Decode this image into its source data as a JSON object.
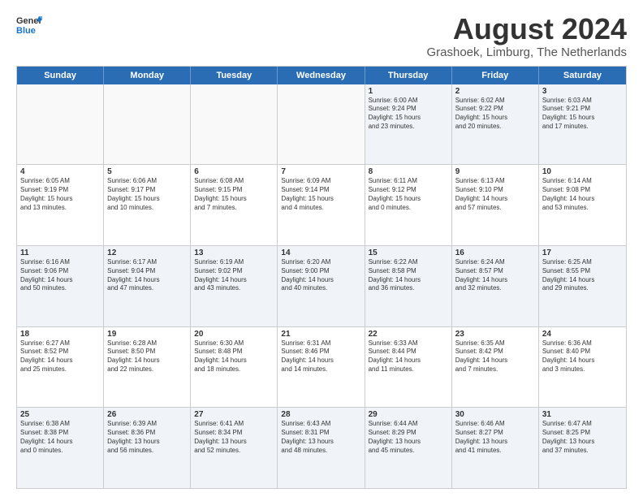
{
  "logo": {
    "text_general": "General",
    "text_blue": "Blue"
  },
  "title": "August 2024",
  "subtitle": "Grashoek, Limburg, The Netherlands",
  "header_days": [
    "Sunday",
    "Monday",
    "Tuesday",
    "Wednesday",
    "Thursday",
    "Friday",
    "Saturday"
  ],
  "rows": [
    [
      {
        "day": "",
        "info": "",
        "empty": true
      },
      {
        "day": "",
        "info": "",
        "empty": true
      },
      {
        "day": "",
        "info": "",
        "empty": true
      },
      {
        "day": "",
        "info": "",
        "empty": true
      },
      {
        "day": "1",
        "info": "Sunrise: 6:00 AM\nSunset: 9:24 PM\nDaylight: 15 hours\nand 23 minutes."
      },
      {
        "day": "2",
        "info": "Sunrise: 6:02 AM\nSunset: 9:22 PM\nDaylight: 15 hours\nand 20 minutes."
      },
      {
        "day": "3",
        "info": "Sunrise: 6:03 AM\nSunset: 9:21 PM\nDaylight: 15 hours\nand 17 minutes."
      }
    ],
    [
      {
        "day": "4",
        "info": "Sunrise: 6:05 AM\nSunset: 9:19 PM\nDaylight: 15 hours\nand 13 minutes."
      },
      {
        "day": "5",
        "info": "Sunrise: 6:06 AM\nSunset: 9:17 PM\nDaylight: 15 hours\nand 10 minutes."
      },
      {
        "day": "6",
        "info": "Sunrise: 6:08 AM\nSunset: 9:15 PM\nDaylight: 15 hours\nand 7 minutes."
      },
      {
        "day": "7",
        "info": "Sunrise: 6:09 AM\nSunset: 9:14 PM\nDaylight: 15 hours\nand 4 minutes."
      },
      {
        "day": "8",
        "info": "Sunrise: 6:11 AM\nSunset: 9:12 PM\nDaylight: 15 hours\nand 0 minutes."
      },
      {
        "day": "9",
        "info": "Sunrise: 6:13 AM\nSunset: 9:10 PM\nDaylight: 14 hours\nand 57 minutes."
      },
      {
        "day": "10",
        "info": "Sunrise: 6:14 AM\nSunset: 9:08 PM\nDaylight: 14 hours\nand 53 minutes."
      }
    ],
    [
      {
        "day": "11",
        "info": "Sunrise: 6:16 AM\nSunset: 9:06 PM\nDaylight: 14 hours\nand 50 minutes."
      },
      {
        "day": "12",
        "info": "Sunrise: 6:17 AM\nSunset: 9:04 PM\nDaylight: 14 hours\nand 47 minutes."
      },
      {
        "day": "13",
        "info": "Sunrise: 6:19 AM\nSunset: 9:02 PM\nDaylight: 14 hours\nand 43 minutes."
      },
      {
        "day": "14",
        "info": "Sunrise: 6:20 AM\nSunset: 9:00 PM\nDaylight: 14 hours\nand 40 minutes."
      },
      {
        "day": "15",
        "info": "Sunrise: 6:22 AM\nSunset: 8:58 PM\nDaylight: 14 hours\nand 36 minutes."
      },
      {
        "day": "16",
        "info": "Sunrise: 6:24 AM\nSunset: 8:57 PM\nDaylight: 14 hours\nand 32 minutes."
      },
      {
        "day": "17",
        "info": "Sunrise: 6:25 AM\nSunset: 8:55 PM\nDaylight: 14 hours\nand 29 minutes."
      }
    ],
    [
      {
        "day": "18",
        "info": "Sunrise: 6:27 AM\nSunset: 8:52 PM\nDaylight: 14 hours\nand 25 minutes."
      },
      {
        "day": "19",
        "info": "Sunrise: 6:28 AM\nSunset: 8:50 PM\nDaylight: 14 hours\nand 22 minutes."
      },
      {
        "day": "20",
        "info": "Sunrise: 6:30 AM\nSunset: 8:48 PM\nDaylight: 14 hours\nand 18 minutes."
      },
      {
        "day": "21",
        "info": "Sunrise: 6:31 AM\nSunset: 8:46 PM\nDaylight: 14 hours\nand 14 minutes."
      },
      {
        "day": "22",
        "info": "Sunrise: 6:33 AM\nSunset: 8:44 PM\nDaylight: 14 hours\nand 11 minutes."
      },
      {
        "day": "23",
        "info": "Sunrise: 6:35 AM\nSunset: 8:42 PM\nDaylight: 14 hours\nand 7 minutes."
      },
      {
        "day": "24",
        "info": "Sunrise: 6:36 AM\nSunset: 8:40 PM\nDaylight: 14 hours\nand 3 minutes."
      }
    ],
    [
      {
        "day": "25",
        "info": "Sunrise: 6:38 AM\nSunset: 8:38 PM\nDaylight: 14 hours\nand 0 minutes."
      },
      {
        "day": "26",
        "info": "Sunrise: 6:39 AM\nSunset: 8:36 PM\nDaylight: 13 hours\nand 56 minutes."
      },
      {
        "day": "27",
        "info": "Sunrise: 6:41 AM\nSunset: 8:34 PM\nDaylight: 13 hours\nand 52 minutes."
      },
      {
        "day": "28",
        "info": "Sunrise: 6:43 AM\nSunset: 8:31 PM\nDaylight: 13 hours\nand 48 minutes."
      },
      {
        "day": "29",
        "info": "Sunrise: 6:44 AM\nSunset: 8:29 PM\nDaylight: 13 hours\nand 45 minutes."
      },
      {
        "day": "30",
        "info": "Sunrise: 6:46 AM\nSunset: 8:27 PM\nDaylight: 13 hours\nand 41 minutes."
      },
      {
        "day": "31",
        "info": "Sunrise: 6:47 AM\nSunset: 8:25 PM\nDaylight: 13 hours\nand 37 minutes."
      }
    ]
  ],
  "alt_rows": [
    0,
    2,
    4
  ]
}
